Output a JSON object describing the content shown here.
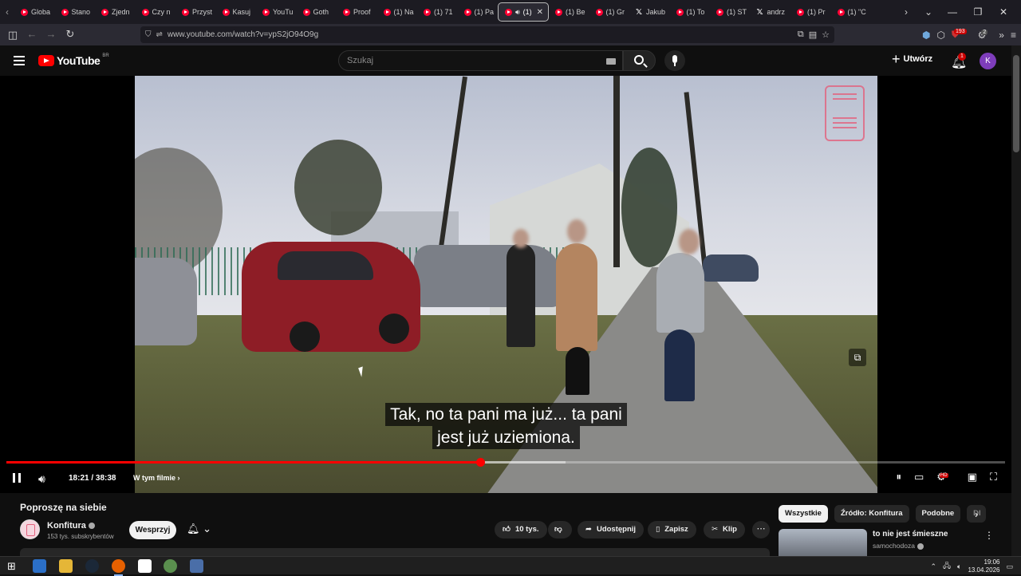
{
  "browser": {
    "tabs": [
      {
        "label": "Globa",
        "icon": "youtube-icon"
      },
      {
        "label": "Stano",
        "icon": "youtube-icon"
      },
      {
        "label": "Zjedn",
        "icon": "youtube-icon"
      },
      {
        "label": "Czy n",
        "icon": "youtube-icon"
      },
      {
        "label": "Przyst",
        "icon": "youtube-icon"
      },
      {
        "label": "Kasuj",
        "icon": "youtube-icon"
      },
      {
        "label": "YouTu",
        "icon": "youtube-icon"
      },
      {
        "label": "Goth",
        "icon": "youtube-icon"
      },
      {
        "label": "Proof",
        "icon": "youtube-icon"
      },
      {
        "label": "(1) Na",
        "icon": "youtube-icon"
      },
      {
        "label": "(1) 71",
        "icon": "youtube-icon"
      },
      {
        "label": "(1) Pa",
        "icon": "youtube-icon"
      },
      {
        "label": "(1)",
        "icon": "youtube-icon",
        "active": true
      },
      {
        "label": "(1) Be",
        "icon": "youtube-icon"
      },
      {
        "label": "(1) Gr",
        "icon": "youtube-icon"
      },
      {
        "label": "Jakub",
        "icon": "x-icon"
      },
      {
        "label": "(1) To",
        "icon": "youtube-icon"
      },
      {
        "label": "(1) ST",
        "icon": "youtube-icon"
      },
      {
        "label": "andrz",
        "icon": "x-icon"
      },
      {
        "label": "(1) Pr",
        "icon": "youtube-icon"
      },
      {
        "label": "(1) \"C",
        "icon": "youtube-icon"
      }
    ],
    "url": "www.youtube.com/watch?v=ypS2jO94O9g",
    "ext_badge_1": "193",
    "ext_badge_2": "2"
  },
  "youtube": {
    "logo_text": "YouTube",
    "country": "BR",
    "search_placeholder": "Szukaj",
    "create_label": "Utwórz",
    "notif_count": "1",
    "avatar_letter": "K",
    "avatar_color": "#7e3dbb"
  },
  "player": {
    "subtitle_line1": "Tak, no ta pani ma już... ta pani",
    "subtitle_line2": "jest już uziemiona.",
    "current_time": "18:21",
    "duration": "38:38",
    "time_display": "18:21 / 38:38",
    "chapter_label": "W tym filmie",
    "progress_played_fraction": 0.4746,
    "progress_color": "#ff0000"
  },
  "video": {
    "title": "Poproszę na siebie",
    "channel": "Konfitura",
    "subscribers": "153 tys. subskrybentów",
    "support_label": "Wesprzyj",
    "likes": "10 tys.",
    "share_label": "Udostępnij",
    "save_label": "Zapisz",
    "clip_label": "Klip"
  },
  "sidebar": {
    "chips": [
      "Wszystkie",
      "Źródło: Konfitura",
      "Podobne",
      "Dl"
    ],
    "rec_title": "to nie jest śmieszne",
    "rec_channel": "samochodoza"
  },
  "taskbar": {
    "time": "19:06",
    "date": "13.04.2026"
  }
}
